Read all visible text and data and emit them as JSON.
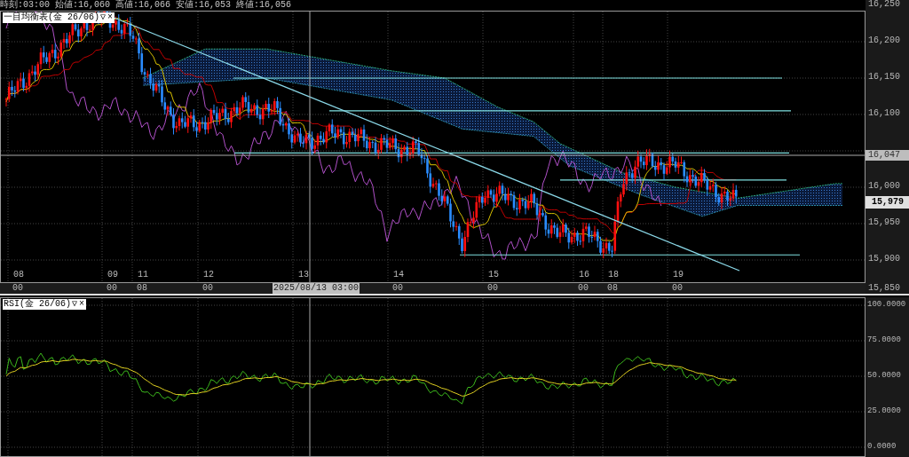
{
  "quote_bar": [
    "時刻:03:00",
    "始値:16,060",
    "高値:16,066",
    "安値:16,053",
    "終値:16,056"
  ],
  "main_chart": {
    "legend": {
      "title": "一目均衡表(金 26/06)",
      "menu_glyph": "▽",
      "close_glyph": "×"
    },
    "price_labels": [
      "16,250",
      "16,200",
      "16,150",
      "16,100",
      "16,000",
      "15,950",
      "15,900",
      "15,850"
    ],
    "crosshair_price": "16,047",
    "current_price": "15,979",
    "time_labels": [
      {
        "day": "08",
        "hour": "00"
      },
      {
        "day": "09",
        "hour": "00"
      },
      {
        "day": "11",
        "hour": "08"
      },
      {
        "day": "12",
        "hour": "00"
      },
      {
        "day": "13"
      },
      {
        "day": "14",
        "hour": "00"
      },
      {
        "day": "15",
        "hour": "00"
      },
      {
        "day": "16",
        "hour": "00"
      },
      {
        "day": "18",
        "hour": "08"
      },
      {
        "day": "19",
        "hour": "00"
      }
    ],
    "crosshair_time": "2025/08/13 03:00"
  },
  "rsi_panel": {
    "legend": {
      "title": "RSI(金 26/06)",
      "menu_glyph": "▽",
      "close_glyph": "×"
    },
    "value_labels": [
      "100.0000",
      "75.0000",
      "50.0000",
      "25.0000",
      "0.0000"
    ]
  }
}
